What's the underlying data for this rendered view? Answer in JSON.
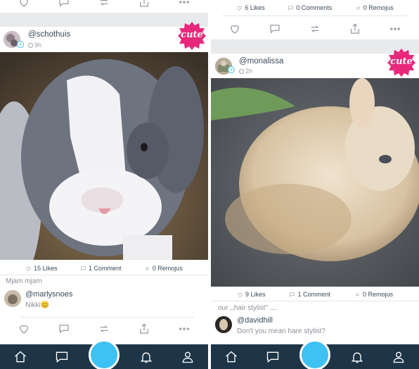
{
  "left": {
    "post": {
      "username": "@schothuis",
      "time": "9h",
      "badge": "cute",
      "likes": "15 Likes",
      "comments": "1 Comment",
      "remojus": "0 Remojus",
      "caption": "Mjam mjam",
      "comment": {
        "user": "@marlysnoes",
        "text": "Nikki😊"
      }
    }
  },
  "right": {
    "prev_stats": {
      "likes": "6 Likes",
      "comments": "0 Comments",
      "remojus": "0 Remojus"
    },
    "post": {
      "username": "@monalissa",
      "time": "2h",
      "badge": "cute",
      "likes": "9 Likes",
      "comments": "1 Comment",
      "remojus": "0 Remojus",
      "caption": "our ,,hair stylist\" ....",
      "comment": {
        "user": "@davidhill",
        "text": "Don't you mean hare stylist?"
      }
    }
  },
  "icons": {
    "actions": [
      "heart-icon",
      "comment-icon",
      "remoji-icon",
      "share-icon",
      "more-icon"
    ],
    "tabs": [
      "home-icon",
      "chat-icon",
      "camera-button",
      "bell-icon",
      "profile-icon"
    ]
  },
  "colors": {
    "accent": "#3ec1f3",
    "tabbar": "#1d3547",
    "badge": "#e8287a"
  }
}
